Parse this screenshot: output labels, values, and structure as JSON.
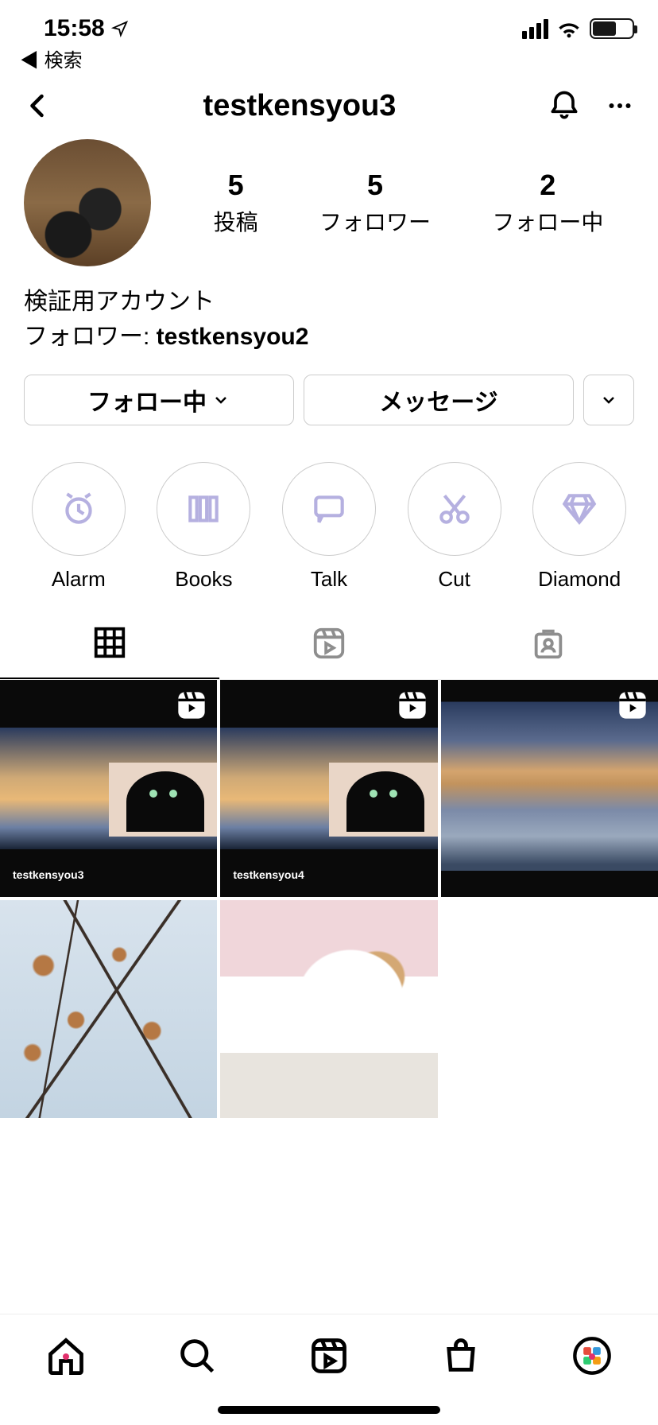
{
  "status": {
    "time": "15:58",
    "back_app": "検索"
  },
  "header": {
    "username": "testkensyou3"
  },
  "stats": {
    "posts": {
      "value": "5",
      "label": "投稿"
    },
    "followers": {
      "value": "5",
      "label": "フォロワー"
    },
    "following": {
      "value": "2",
      "label": "フォロー中"
    }
  },
  "bio": {
    "line1": "検証用アカウント",
    "follower_prefix": "フォロワー: ",
    "follower_name": "testkensyou2"
  },
  "actions": {
    "following": "フォロー中",
    "message": "メッセージ"
  },
  "highlights": [
    {
      "name": "Alarm"
    },
    {
      "name": "Books"
    },
    {
      "name": "Talk"
    },
    {
      "name": "Cut"
    },
    {
      "name": "Diamond"
    }
  ],
  "posts": [
    {
      "is_reel": true,
      "caption": "testkensyou3"
    },
    {
      "is_reel": true,
      "caption": "testkensyou4"
    },
    {
      "is_reel": true,
      "caption": ""
    },
    {
      "is_reel": false,
      "caption": ""
    },
    {
      "is_reel": false,
      "caption": ""
    }
  ]
}
